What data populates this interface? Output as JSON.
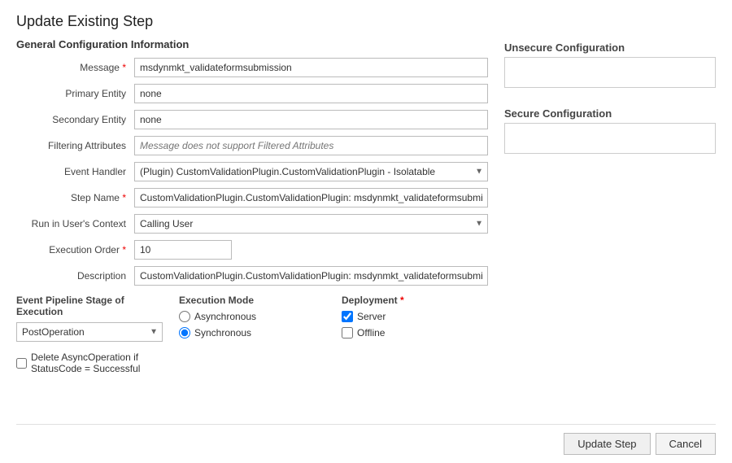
{
  "page": {
    "title": "Update Existing Step"
  },
  "sections": {
    "general": "General Configuration Information",
    "unsecure": "Unsecure  Configuration",
    "secure": "Secure  Configuration"
  },
  "form": {
    "message_label": "Message",
    "message_value": "msdynmkt_validateformsubmission",
    "primary_entity_label": "Primary Entity",
    "primary_entity_value": "none",
    "secondary_entity_label": "Secondary Entity",
    "secondary_entity_value": "none",
    "filtering_attributes_label": "Filtering Attributes",
    "filtering_attributes_placeholder": "Message does not support Filtered Attributes",
    "event_handler_label": "Event Handler",
    "event_handler_value": "(Plugin) CustomValidationPlugin.CustomValidationPlugin - Isolatable",
    "step_name_label": "Step Name",
    "step_name_value": "CustomValidationPlugin.CustomValidationPlugin: msdynmkt_validateformsubmission of any Ent",
    "run_in_users_context_label": "Run in User's Context",
    "run_in_users_context_value": "Calling User",
    "execution_order_label": "Execution Order",
    "execution_order_value": "10",
    "description_label": "Description",
    "description_value": "CustomValidationPlugin.CustomValidationPlugin: msdynmkt_validateformsubmission of any Ent"
  },
  "bottom": {
    "pipeline_stage_label": "Event Pipeline Stage of Execution",
    "pipeline_stage_value": "PostOperation",
    "execution_mode_label": "Execution Mode",
    "execution_mode_asynchronous": "Asynchronous",
    "execution_mode_synchronous": "Synchronous",
    "synchronous_selected": true,
    "deployment_label": "Deployment",
    "deployment_server": "Server",
    "deployment_offline": "Offline",
    "server_checked": true,
    "offline_checked": false,
    "delete_checkbox_label": "Delete AsyncOperation if StatusCode = Successful"
  },
  "footer": {
    "update_step_label": "Update Step",
    "cancel_label": "Cancel"
  }
}
